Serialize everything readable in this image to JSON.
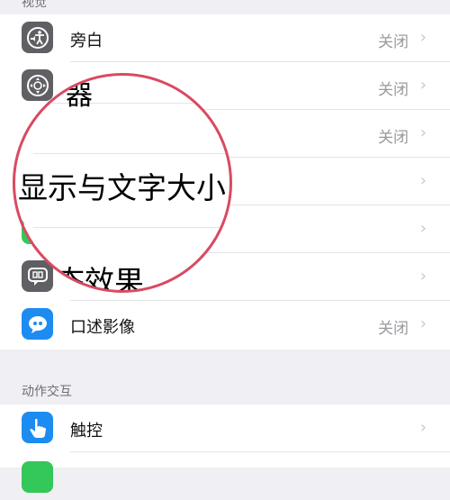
{
  "sections": {
    "vision_header": "视觉",
    "motion_header": "动作交互"
  },
  "rows": {
    "voiceover": {
      "label": "旁白",
      "value": "关闭",
      "icon": "voiceover-accessibility-icon"
    },
    "zoom": {
      "label": "缩放器",
      "value": "关闭",
      "icon": "magnifier-icon"
    },
    "row3": {
      "value": "关闭"
    },
    "display_text_size": {
      "label": "显示与文字大小"
    },
    "motion_effect": {
      "label": "动态效果",
      "icon": "motion-icon"
    },
    "audio_desc": {
      "label": "口述影像",
      "value": "关闭",
      "icon": "speech-bubble-icon"
    },
    "touch": {
      "label": "触控",
      "icon": "hand-touch-icon"
    }
  },
  "magnifier": {
    "line1": "器",
    "line2": "显示与文字大小",
    "line3": "态效果"
  },
  "chevron": "›",
  "colors": {
    "background": "#efeff4",
    "row": "#ffffff",
    "magnifier_ring": "#d94a62",
    "icon_gray": "#5f5f64",
    "icon_blue": "#1d8cf0",
    "icon_green": "#34c759",
    "secondary_text": "#9a9a9f"
  }
}
